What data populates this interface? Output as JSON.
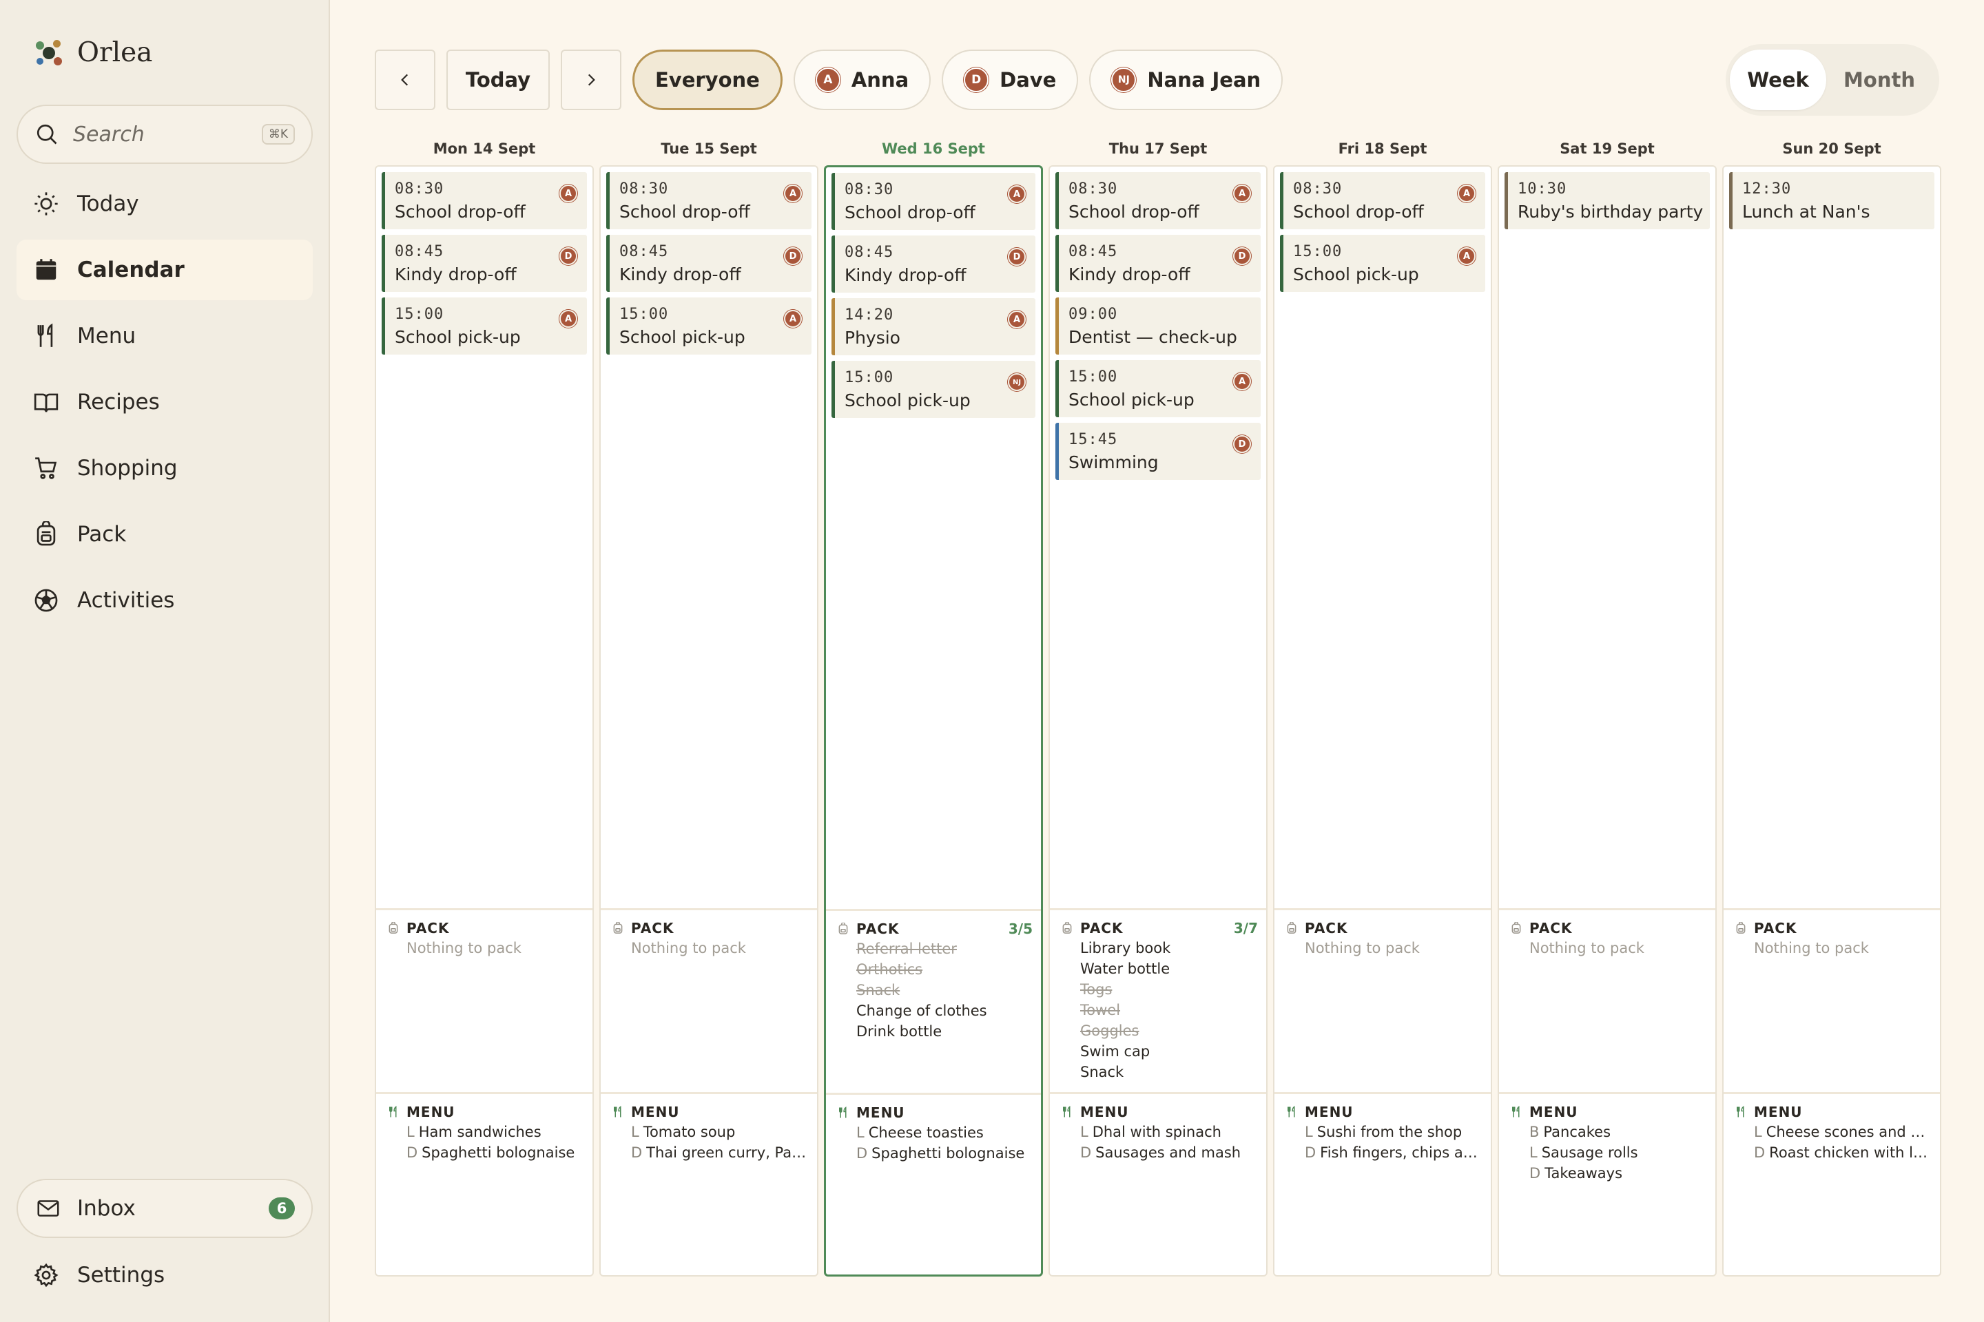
{
  "app": {
    "name": "Orlea"
  },
  "search": {
    "placeholder": "Search",
    "shortcut": "⌘K"
  },
  "nav": {
    "items": [
      {
        "label": "Today",
        "icon": "sun-icon"
      },
      {
        "label": "Calendar",
        "icon": "calendar-icon",
        "active": true
      },
      {
        "label": "Menu",
        "icon": "fork-knife-icon"
      },
      {
        "label": "Recipes",
        "icon": "book-icon"
      },
      {
        "label": "Shopping",
        "icon": "cart-icon"
      },
      {
        "label": "Pack",
        "icon": "backpack-icon"
      },
      {
        "label": "Activities",
        "icon": "ball-icon"
      }
    ],
    "inbox": {
      "label": "Inbox",
      "count": "6"
    },
    "settings": {
      "label": "Settings"
    }
  },
  "toolbar": {
    "today_label": "Today",
    "filters": [
      {
        "label": "Everyone",
        "initials": "",
        "selected": true
      },
      {
        "label": "Anna",
        "initials": "A"
      },
      {
        "label": "Dave",
        "initials": "D"
      },
      {
        "label": "Nana Jean",
        "initials": "NJ"
      }
    ],
    "views": {
      "week": "Week",
      "month": "Month",
      "selected": "Week"
    }
  },
  "colors": {
    "accent": "#4f8a57",
    "avatar": "#a9563a",
    "background": "#fcf6ec"
  },
  "days": [
    {
      "label": "Mon 14 Sept",
      "events": [
        {
          "time": "08:30",
          "title": "School drop-off",
          "who": "A",
          "color": "green"
        },
        {
          "time": "08:45",
          "title": "Kindy drop-off",
          "who": "D",
          "color": "green"
        },
        {
          "time": "15:00",
          "title": "School pick-up",
          "who": "A",
          "color": "green"
        }
      ],
      "pack": {
        "title": "PACK",
        "count": "",
        "items": [
          {
            "text": "Nothing to pack",
            "state": "empty"
          }
        ]
      },
      "menu": {
        "title": "MENU",
        "items": [
          {
            "k": "L",
            "text": "Ham sandwiches"
          },
          {
            "k": "D",
            "text": "Spaghetti bolognaise"
          }
        ]
      }
    },
    {
      "label": "Tue 15 Sept",
      "events": [
        {
          "time": "08:30",
          "title": "School drop-off",
          "who": "A",
          "color": "green"
        },
        {
          "time": "08:45",
          "title": "Kindy drop-off",
          "who": "D",
          "color": "green"
        },
        {
          "time": "15:00",
          "title": "School pick-up",
          "who": "A",
          "color": "green"
        }
      ],
      "pack": {
        "title": "PACK",
        "count": "",
        "items": [
          {
            "text": "Nothing to pack",
            "state": "empty"
          }
        ]
      },
      "menu": {
        "title": "MENU",
        "items": [
          {
            "k": "L",
            "text": "Tomato soup"
          },
          {
            "k": "D",
            "text": "Thai green curry, Pasta"
          }
        ]
      }
    },
    {
      "label": "Wed 16 Sept",
      "today": true,
      "events": [
        {
          "time": "08:30",
          "title": "School drop-off",
          "who": "A",
          "color": "green"
        },
        {
          "time": "08:45",
          "title": "Kindy drop-off",
          "who": "D",
          "color": "green"
        },
        {
          "time": "14:20",
          "title": "Physio",
          "who": "A",
          "color": "tan"
        },
        {
          "time": "15:00",
          "title": "School pick-up",
          "who": "NJ",
          "color": "green"
        }
      ],
      "pack": {
        "title": "PACK",
        "count": "3/5",
        "items": [
          {
            "text": "Referral letter",
            "state": "done"
          },
          {
            "text": "Orthotics",
            "state": "done"
          },
          {
            "text": "Snack",
            "state": "done"
          },
          {
            "text": "Change of clothes",
            "state": "todo"
          },
          {
            "text": "Drink bottle",
            "state": "todo"
          }
        ]
      },
      "menu": {
        "title": "MENU",
        "items": [
          {
            "k": "L",
            "text": "Cheese toasties"
          },
          {
            "k": "D",
            "text": "Spaghetti bolognaise"
          }
        ]
      }
    },
    {
      "label": "Thu 17 Sept",
      "events": [
        {
          "time": "08:30",
          "title": "School drop-off",
          "who": "A",
          "color": "green"
        },
        {
          "time": "08:45",
          "title": "Kindy drop-off",
          "who": "D",
          "color": "green"
        },
        {
          "time": "09:00",
          "title": "Dentist — check-up",
          "who": "",
          "color": "tan"
        },
        {
          "time": "15:00",
          "title": "School pick-up",
          "who": "A",
          "color": "green"
        },
        {
          "time": "15:45",
          "title": "Swimming",
          "who": "D",
          "color": "blue"
        }
      ],
      "pack": {
        "title": "PACK",
        "count": "3/7",
        "items": [
          {
            "text": "Library book",
            "state": "todo"
          },
          {
            "text": "Water bottle",
            "state": "todo"
          },
          {
            "text": "Togs",
            "state": "done"
          },
          {
            "text": "Towel",
            "state": "done"
          },
          {
            "text": "Goggles",
            "state": "done"
          },
          {
            "text": "Swim cap",
            "state": "todo"
          },
          {
            "text": "Snack",
            "state": "todo"
          }
        ]
      },
      "menu": {
        "title": "MENU",
        "items": [
          {
            "k": "L",
            "text": "Dhal with spinach"
          },
          {
            "k": "D",
            "text": "Sausages and mash"
          }
        ]
      }
    },
    {
      "label": "Fri 18 Sept",
      "events": [
        {
          "time": "08:30",
          "title": "School drop-off",
          "who": "A",
          "color": "green"
        },
        {
          "time": "15:00",
          "title": "School pick-up",
          "who": "A",
          "color": "green"
        }
      ],
      "pack": {
        "title": "PACK",
        "count": "",
        "items": [
          {
            "text": "Nothing to pack",
            "state": "empty"
          }
        ]
      },
      "menu": {
        "title": "MENU",
        "items": [
          {
            "k": "L",
            "text": "Sushi from the shop"
          },
          {
            "k": "D",
            "text": "Fish fingers, chips and peas"
          }
        ]
      }
    },
    {
      "label": "Sat 19 Sept",
      "events": [
        {
          "time": "10:30",
          "title": "Ruby's birthday party",
          "who": "",
          "color": "brown"
        }
      ],
      "pack": {
        "title": "PACK",
        "count": "",
        "items": [
          {
            "text": "Nothing to pack",
            "state": "empty"
          }
        ]
      },
      "menu": {
        "title": "MENU",
        "items": [
          {
            "k": "B",
            "text": "Pancakes"
          },
          {
            "k": "L",
            "text": "Sausage rolls"
          },
          {
            "k": "D",
            "text": "Takeaways"
          }
        ]
      }
    },
    {
      "label": "Sun 20 Sept",
      "events": [
        {
          "time": "12:30",
          "title": "Lunch at Nan's",
          "who": "",
          "color": "brown"
        }
      ],
      "pack": {
        "title": "PACK",
        "count": "",
        "items": [
          {
            "text": "Nothing to pack",
            "state": "empty"
          }
        ]
      },
      "menu": {
        "title": "MENU",
        "items": [
          {
            "k": "L",
            "text": "Cheese scones and salad"
          },
          {
            "k": "D",
            "text": "Roast chicken with leeks"
          }
        ]
      }
    }
  ]
}
